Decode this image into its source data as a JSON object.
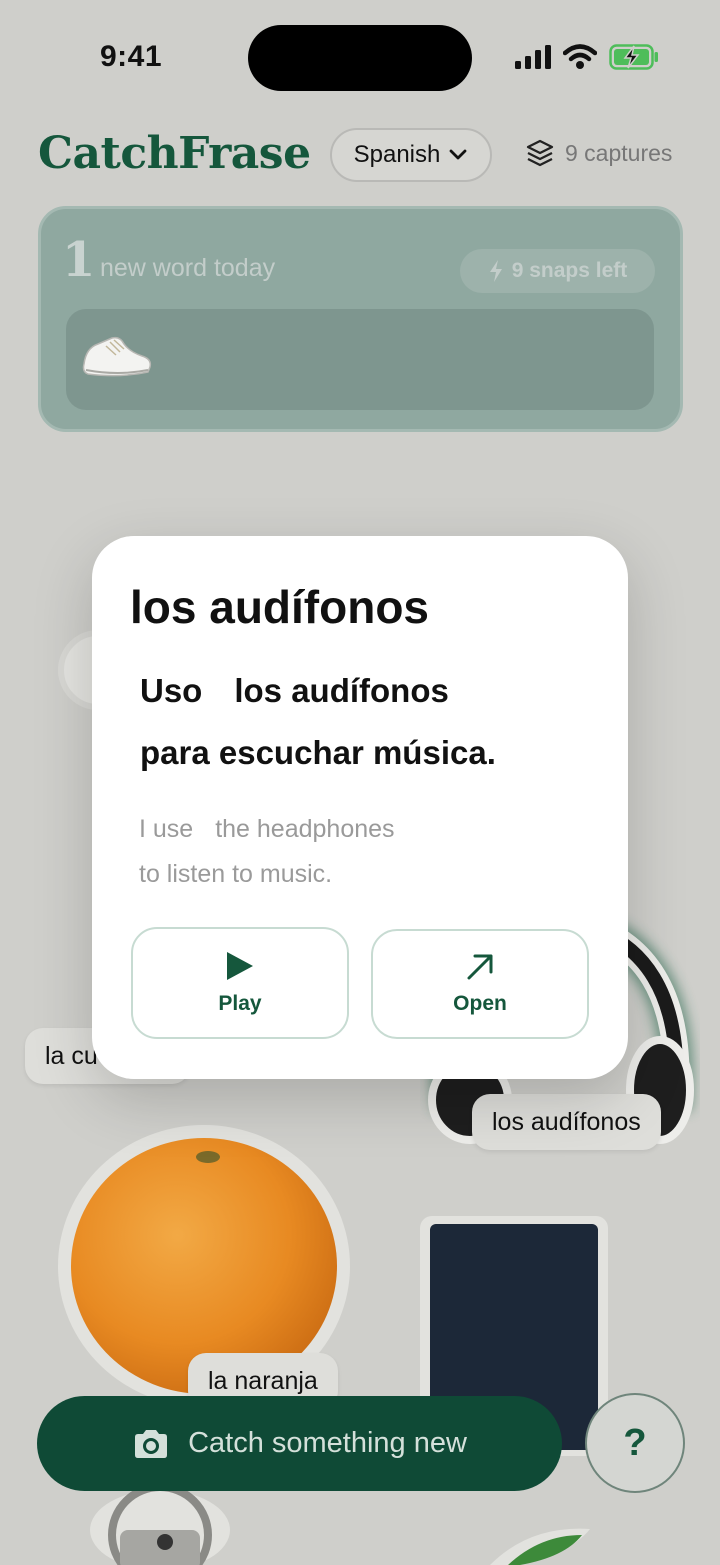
{
  "status_bar": {
    "time": "9:41"
  },
  "header": {
    "brand": "CatchFrase",
    "language": "Spanish",
    "captures": "9 captures"
  },
  "today": {
    "count": "1",
    "label": "new word today",
    "snaps_left": "9 snaps left"
  },
  "stickers": {
    "partial_label": "la cu",
    "headphones_label": "los audífonos",
    "orange_label": "la naranja"
  },
  "modal": {
    "word": "los audífonos",
    "spanish_part1": "Uso",
    "spanish_part2": "los audífonos",
    "spanish_line2": "para escuchar música.",
    "english_part1": "I use",
    "english_part2": "the headphones",
    "english_line2": "to listen to music.",
    "play_label": "Play",
    "open_label": "Open"
  },
  "bottom": {
    "catch_label": "Catch something new",
    "help_label": "?"
  },
  "colors": {
    "brand_green": "#15573c",
    "button_dark_green": "#0f4a36",
    "background": "#cfcfcb",
    "today_card": "#8fa8a0"
  },
  "icons": [
    "signal-icon",
    "wifi-icon",
    "battery-charging-icon",
    "chevron-down-icon",
    "layers-icon",
    "bolt-icon",
    "sneaker-image",
    "headphones-image",
    "orange-image",
    "notebook-image",
    "play-icon",
    "arrow-up-right-icon",
    "camera-icon",
    "help-icon"
  ]
}
